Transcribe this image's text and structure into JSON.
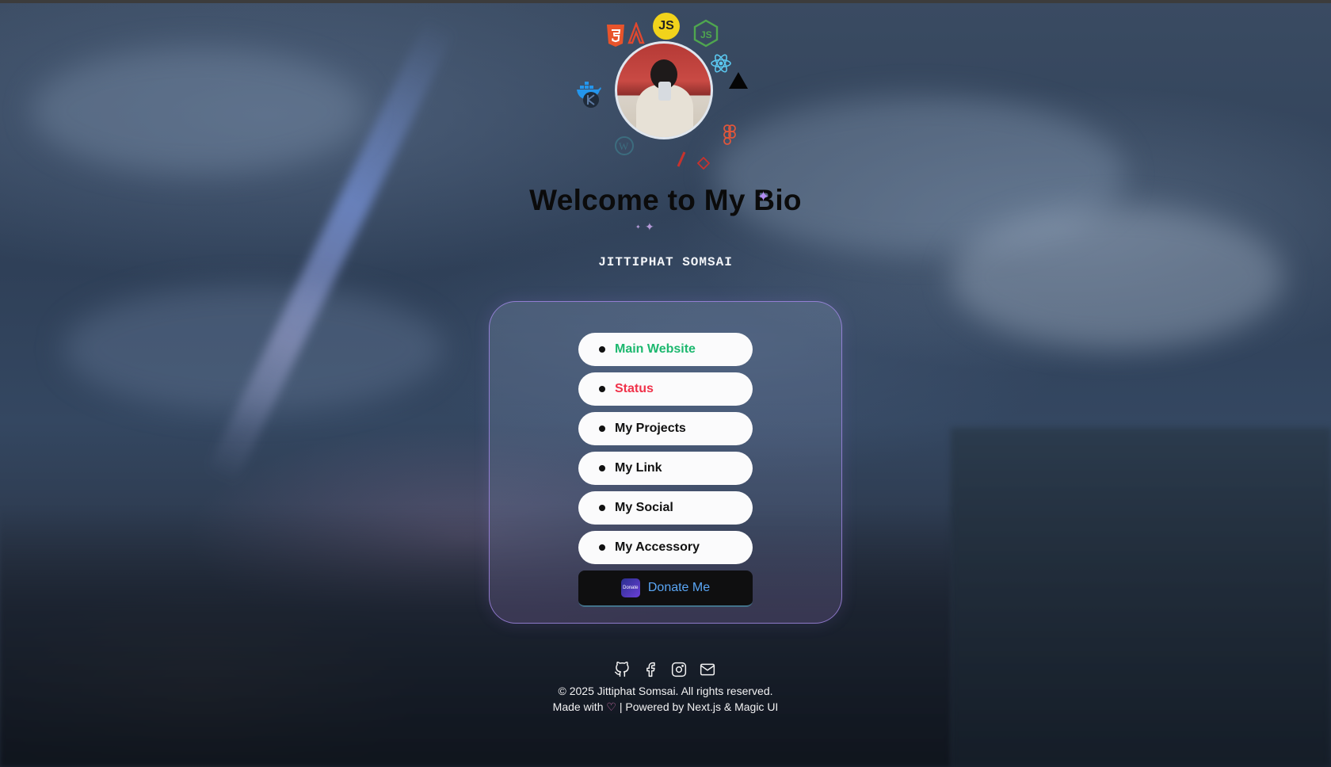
{
  "page": {
    "title": "Welcome to My Bio",
    "subtitle": "JITTIPHAT SOMSAI"
  },
  "orbit_icons": [
    "html5-icon",
    "angular-icon",
    "js-icon",
    "nodejs-icon",
    "react-icon",
    "vercel-icon",
    "docker-icon",
    "kubernetes-icon",
    "figma-icon",
    "wordpress-icon",
    "pen-icon",
    "git-icon"
  ],
  "menu": [
    {
      "label": "Main Website",
      "color": "#1db86f"
    },
    {
      "label": "Status",
      "color": "#f0324a"
    },
    {
      "label": "My Projects",
      "color": "#111111"
    },
    {
      "label": "My Link",
      "color": "#111111"
    },
    {
      "label": "My Social",
      "color": "#111111"
    },
    {
      "label": "My Accessory",
      "color": "#111111"
    }
  ],
  "donate": {
    "label": "Donate Me",
    "logo_text": "Donate"
  },
  "icons": {
    "js": "JS"
  },
  "social": [
    "github-icon",
    "facebook-icon",
    "instagram-icon",
    "mail-icon"
  ],
  "footer": {
    "copyright": "© 2025 Jittiphat Somsai. All rights reserved.",
    "made_with": "Made with",
    "powered": "| Powered by Next.js & Magic UI"
  },
  "colors": {
    "accent": "#b48cf2",
    "donate_text": "#5aa6f5"
  }
}
